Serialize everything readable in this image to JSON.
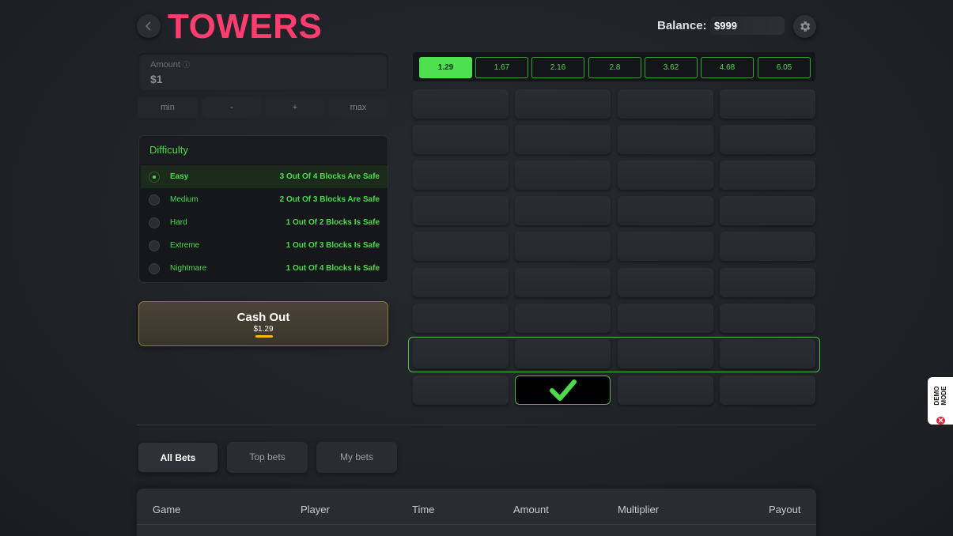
{
  "header": {
    "title": "TOWERS",
    "balance_label": "Balance:",
    "balance_value": "$999"
  },
  "amount": {
    "label": "Amount",
    "value": "$1",
    "buttons": [
      "min",
      "-",
      "+",
      "max"
    ]
  },
  "difficulty": {
    "title": "Difficulty",
    "selected": "Easy",
    "options": [
      {
        "name": "Easy",
        "description": "3 Out Of 4 Blocks Are Safe"
      },
      {
        "name": "Medium",
        "description": "2 Out Of 3 Blocks Are Safe"
      },
      {
        "name": "Hard",
        "description": "1 Out Of 2 Blocks Is Safe"
      },
      {
        "name": "Extreme",
        "description": "1 Out Of 3 Blocks Is Safe"
      },
      {
        "name": "Nightmare",
        "description": "1 Out Of 4 Blocks Is Safe"
      }
    ]
  },
  "cashout": {
    "label": "Cash Out",
    "amount": "$1.29"
  },
  "multipliers": {
    "active_index": 0,
    "values": [
      "1.29",
      "1.67",
      "2.16",
      "2.8",
      "3.62",
      "4.68",
      "6.05"
    ]
  },
  "board": {
    "rows": 9,
    "columns": 4,
    "revealed_safe": {
      "row": 9,
      "column": 2
    },
    "current_row": 8
  },
  "tabs": [
    {
      "label": "All Bets",
      "active": true
    },
    {
      "label": "Top bets",
      "active": false
    },
    {
      "label": "My bets",
      "active": false
    }
  ],
  "table": {
    "columns": [
      "Game",
      "Player",
      "Time",
      "Amount",
      "Multiplier",
      "Payout"
    ]
  },
  "demo_badge": "DEMO MODE",
  "colors": {
    "accent_green": "#4ddb4d",
    "logo_pink": "#ff3d6e",
    "cashout_gold": "#ffb800"
  }
}
